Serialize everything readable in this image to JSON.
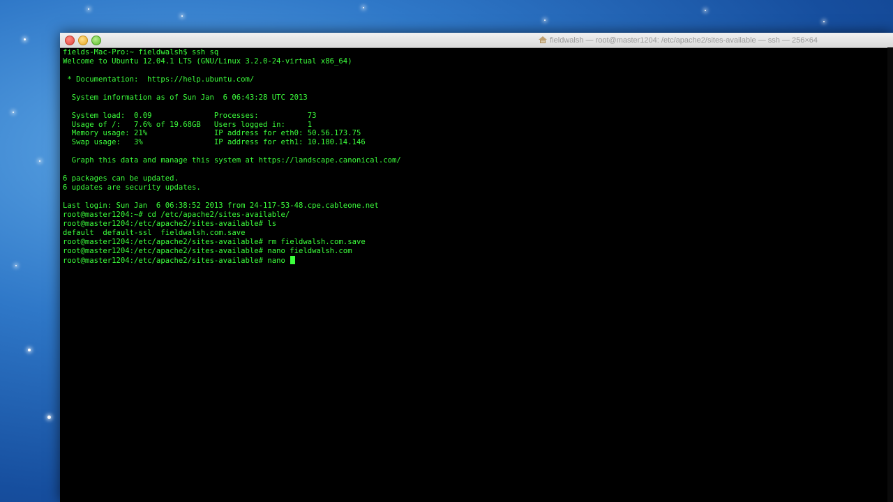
{
  "window": {
    "title": "fieldwalsh — root@master1204: /etc/apache2/sites-available — ssh — 256×64"
  },
  "colors": {
    "terminal_bg": "#000000",
    "terminal_fg": "#3cff3c",
    "desktop": "#2f78c8"
  },
  "icons": {
    "home": "home-icon"
  },
  "terminal": {
    "lines": [
      "fields-Mac-Pro:~ fieldwalsh$ ssh sq",
      "Welcome to Ubuntu 12.04.1 LTS (GNU/Linux 3.2.0-24-virtual x86_64)",
      "",
      " * Documentation:  https://help.ubuntu.com/",
      "",
      "  System information as of Sun Jan  6 06:43:28 UTC 2013",
      "",
      "  System load:  0.09              Processes:           73",
      "  Usage of /:   7.6% of 19.68GB   Users logged in:     1",
      "  Memory usage: 21%               IP address for eth0: 50.56.173.75",
      "  Swap usage:   3%                IP address for eth1: 10.180.14.146",
      "",
      "  Graph this data and manage this system at https://landscape.canonical.com/",
      "",
      "6 packages can be updated.",
      "6 updates are security updates.",
      "",
      "Last login: Sun Jan  6 06:38:52 2013 from 24-117-53-48.cpe.cableone.net",
      "root@master1204:~# cd /etc/apache2/sites-available/",
      "root@master1204:/etc/apache2/sites-available# ls",
      "default  default-ssl  fieldwalsh.com.save",
      "root@master1204:/etc/apache2/sites-available# rm fieldwalsh.com.save",
      "root@master1204:/etc/apache2/sites-available# nano fieldwalsh.com"
    ],
    "current_prompt": "root@master1204:/etc/apache2/sites-available# ",
    "current_input": "nano "
  }
}
